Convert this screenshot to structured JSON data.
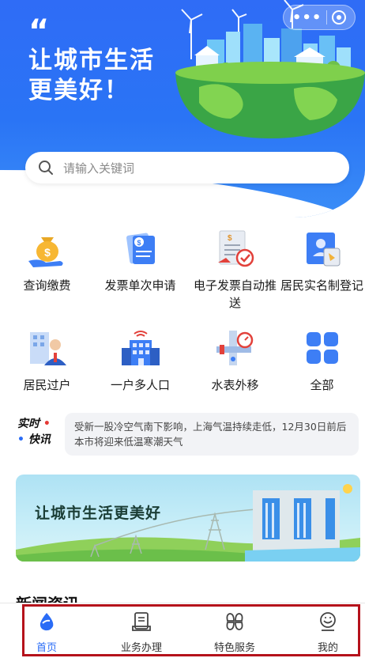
{
  "hero": {
    "quote": "“",
    "title_line1": "让城市生活",
    "title_line2": "更美好！",
    "capsule_more": "•••"
  },
  "search": {
    "placeholder": "请输入关键词"
  },
  "services": [
    {
      "label": "查询缴费",
      "icon": "money-bag-icon"
    },
    {
      "label": "发票单次申请",
      "icon": "invoice-icon"
    },
    {
      "label": "电子发票自动推送",
      "icon": "e-invoice-icon"
    },
    {
      "label": "居民实名制登记",
      "icon": "id-card-icon"
    },
    {
      "label": "居民过户",
      "icon": "person-transfer-icon"
    },
    {
      "label": "一户多人口",
      "icon": "building-icon"
    },
    {
      "label": "水表外移",
      "icon": "water-meter-icon"
    },
    {
      "label": "全部",
      "icon": "grid-icon"
    }
  ],
  "ticker": {
    "tag_line1": "实时",
    "tag_line2": "快讯",
    "text": "受新一股冷空气南下影响，上海气温持续走低，12月30日前后本市将迎来低温寒潮天气"
  },
  "banner": {
    "text": "让城市生活更美好"
  },
  "section": {
    "title": "新闻资讯"
  },
  "tabs": [
    {
      "label": "首页",
      "icon": "water-drop-icon",
      "active": true
    },
    {
      "label": "业务办理",
      "icon": "document-icon",
      "active": false
    },
    {
      "label": "特色服务",
      "icon": "four-petal-icon",
      "active": false
    },
    {
      "label": "我的",
      "icon": "smiley-user-icon",
      "active": false
    }
  ],
  "colors": {
    "primary": "#2a6cf6",
    "highlight_frame": "#b5121b"
  }
}
